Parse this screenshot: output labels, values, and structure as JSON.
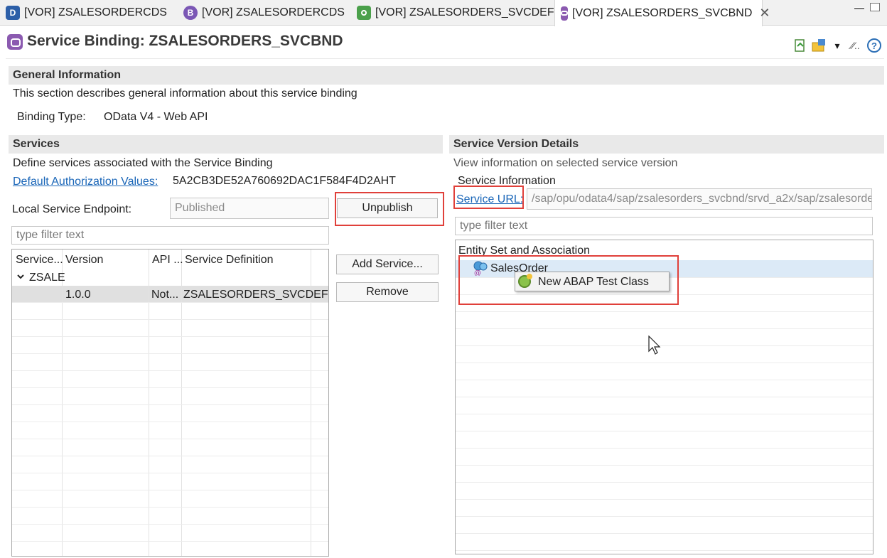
{
  "tabs": [
    {
      "label": "[VOR] ZSALESORDERCDS",
      "icon_letter": "D",
      "icon_color": "#2c5fa8"
    },
    {
      "label": "[VOR] ZSALESORDERCDS",
      "icon_letter": "B",
      "icon_color": "#7b57b5"
    },
    {
      "label": "[VOR] ZSALESORDERS_SVCDEF",
      "icon_letter": "",
      "icon_color": "#4aa04a"
    },
    {
      "label": "[VOR] ZSALESORDERS_SVCBND",
      "icon_letter": "",
      "icon_color": "#8b5ab0"
    }
  ],
  "header": {
    "title": "Service Binding: ZSALESORDERS_SVCBND"
  },
  "general": {
    "heading": "General Information",
    "description": "This section describes general information about this service binding",
    "binding_type_label": "Binding Type:",
    "binding_type_value": "OData V4 - Web API"
  },
  "services": {
    "heading": "Services",
    "description": "Define services associated with the Service Binding",
    "auth_link": "Default Authorization Values:",
    "auth_value": "5A2CB3DE52A760692DAC1F584F4D2AHT",
    "endpoint_label": "Local Service Endpoint:",
    "endpoint_value": "Published",
    "unpublish_label": "Unpublish",
    "filter_placeholder": "type filter text",
    "add_service_label": "Add Service...",
    "remove_label": "Remove",
    "columns": [
      "Service...",
      "Version",
      "API ...",
      "Service Definition"
    ],
    "group_name": "ZSALE",
    "row": {
      "version": "1.0.0",
      "api": "Not...",
      "definition": "ZSALESORDERS_SVCDEF"
    }
  },
  "details": {
    "heading": "Service Version Details",
    "description": "View information on selected service version",
    "info_label": "Service Information",
    "url_link": "Service URL:",
    "url_value": "/sap/opu/odata4/sap/zsalesorders_svcbnd/srvd_a2x/sap/zsalesorde",
    "filter_placeholder": "type filter text",
    "tree_header": "Entity Set and Association",
    "entity": "SalesOrder",
    "context_menu_item": "New ABAP Test Class"
  },
  "colors": {
    "accent_red": "#e0403a",
    "link_blue": "#1a66b8",
    "section_bg": "#e9e9e9"
  }
}
